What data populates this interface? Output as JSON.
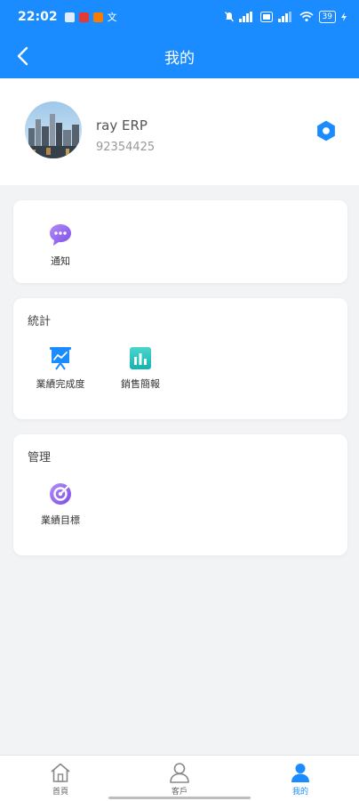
{
  "status_bar": {
    "time": "22:02",
    "battery": "39"
  },
  "header": {
    "title": "我的"
  },
  "profile": {
    "name": "ray ERP",
    "id": "92354425"
  },
  "sections": {
    "general": {
      "items": [
        {
          "label": "通知",
          "icon": "chat-bubble-icon"
        }
      ]
    },
    "stats": {
      "title": "統計",
      "items": [
        {
          "label": "業績完成度",
          "icon": "presentation-chart-icon"
        },
        {
          "label": "銷售簡報",
          "icon": "bar-chart-icon"
        }
      ]
    },
    "manage": {
      "title": "管理",
      "items": [
        {
          "label": "業績目標",
          "icon": "target-icon"
        }
      ]
    }
  },
  "tabbar": {
    "items": [
      {
        "label": "首頁",
        "icon": "home-icon"
      },
      {
        "label": "客戶",
        "icon": "person-icon"
      },
      {
        "label": "我的",
        "icon": "profile-icon",
        "active": true
      }
    ]
  },
  "colors": {
    "primary": "#1a8cff",
    "background": "#f2f3f5",
    "card": "#ffffff"
  }
}
